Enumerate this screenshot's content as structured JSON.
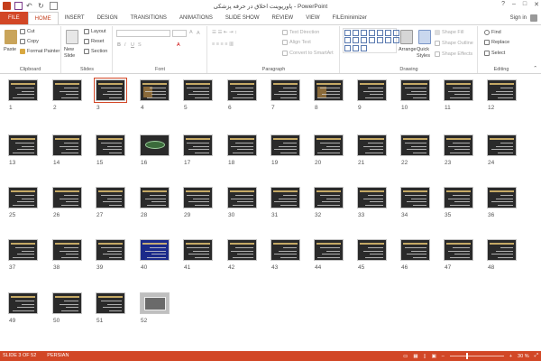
{
  "window": {
    "title": "پاورپوینت اخلاق در حرفه پزشکی - PowerPoint",
    "controls": [
      "?",
      "–",
      "□",
      "✕"
    ]
  },
  "tabs": [
    "FILE",
    "HOME",
    "INSERT",
    "DESIGN",
    "TRANSITIONS",
    "ANIMATIONS",
    "SLIDE SHOW",
    "REVIEW",
    "VIEW",
    "FILEminimizer"
  ],
  "active_tab": "HOME",
  "account": {
    "label": "Sign in"
  },
  "ribbon": {
    "clipboard": {
      "label": "Clipboard",
      "paste": "Paste",
      "cut": "Cut",
      "copy": "Copy",
      "format_painter": "Format Painter"
    },
    "slides": {
      "label": "Slides",
      "new_slide": "New Slide",
      "layout": "Layout",
      "reset": "Reset",
      "section": "Section"
    },
    "font": {
      "label": "Font"
    },
    "paragraph": {
      "label": "Paragraph",
      "text_direction": "Text Direction",
      "align_text": "Align Text",
      "convert": "Convert to SmartArt"
    },
    "drawing": {
      "label": "Drawing",
      "arrange": "Arrange",
      "quick_styles": "Quick Styles",
      "shape_fill": "Shape Fill",
      "shape_outline": "Shape Outline",
      "shape_effects": "Shape Effects"
    },
    "editing": {
      "label": "Editing",
      "find": "Find",
      "replace": "Replace",
      "select": "Select"
    }
  },
  "slides": [
    "1",
    "2",
    "3",
    "4",
    "5",
    "6",
    "7",
    "8",
    "9",
    "10",
    "11",
    "12",
    "13",
    "14",
    "15",
    "16",
    "17",
    "18",
    "19",
    "20",
    "21",
    "22",
    "23",
    "24",
    "25",
    "26",
    "27",
    "28",
    "29",
    "30",
    "31",
    "32",
    "33",
    "34",
    "35",
    "36",
    "37",
    "38",
    "39",
    "40",
    "41",
    "42",
    "43",
    "44",
    "45",
    "46",
    "47",
    "48",
    "49",
    "50",
    "51",
    "52"
  ],
  "selected_slide": 3,
  "status": {
    "slide_info": "SLIDE 3 OF 52",
    "language": "PERSIAN",
    "zoom": "30 %",
    "zoom_minus": "–",
    "zoom_plus": "+"
  },
  "colors": {
    "accent": "#d24726",
    "statusbar": "#d24726"
  }
}
